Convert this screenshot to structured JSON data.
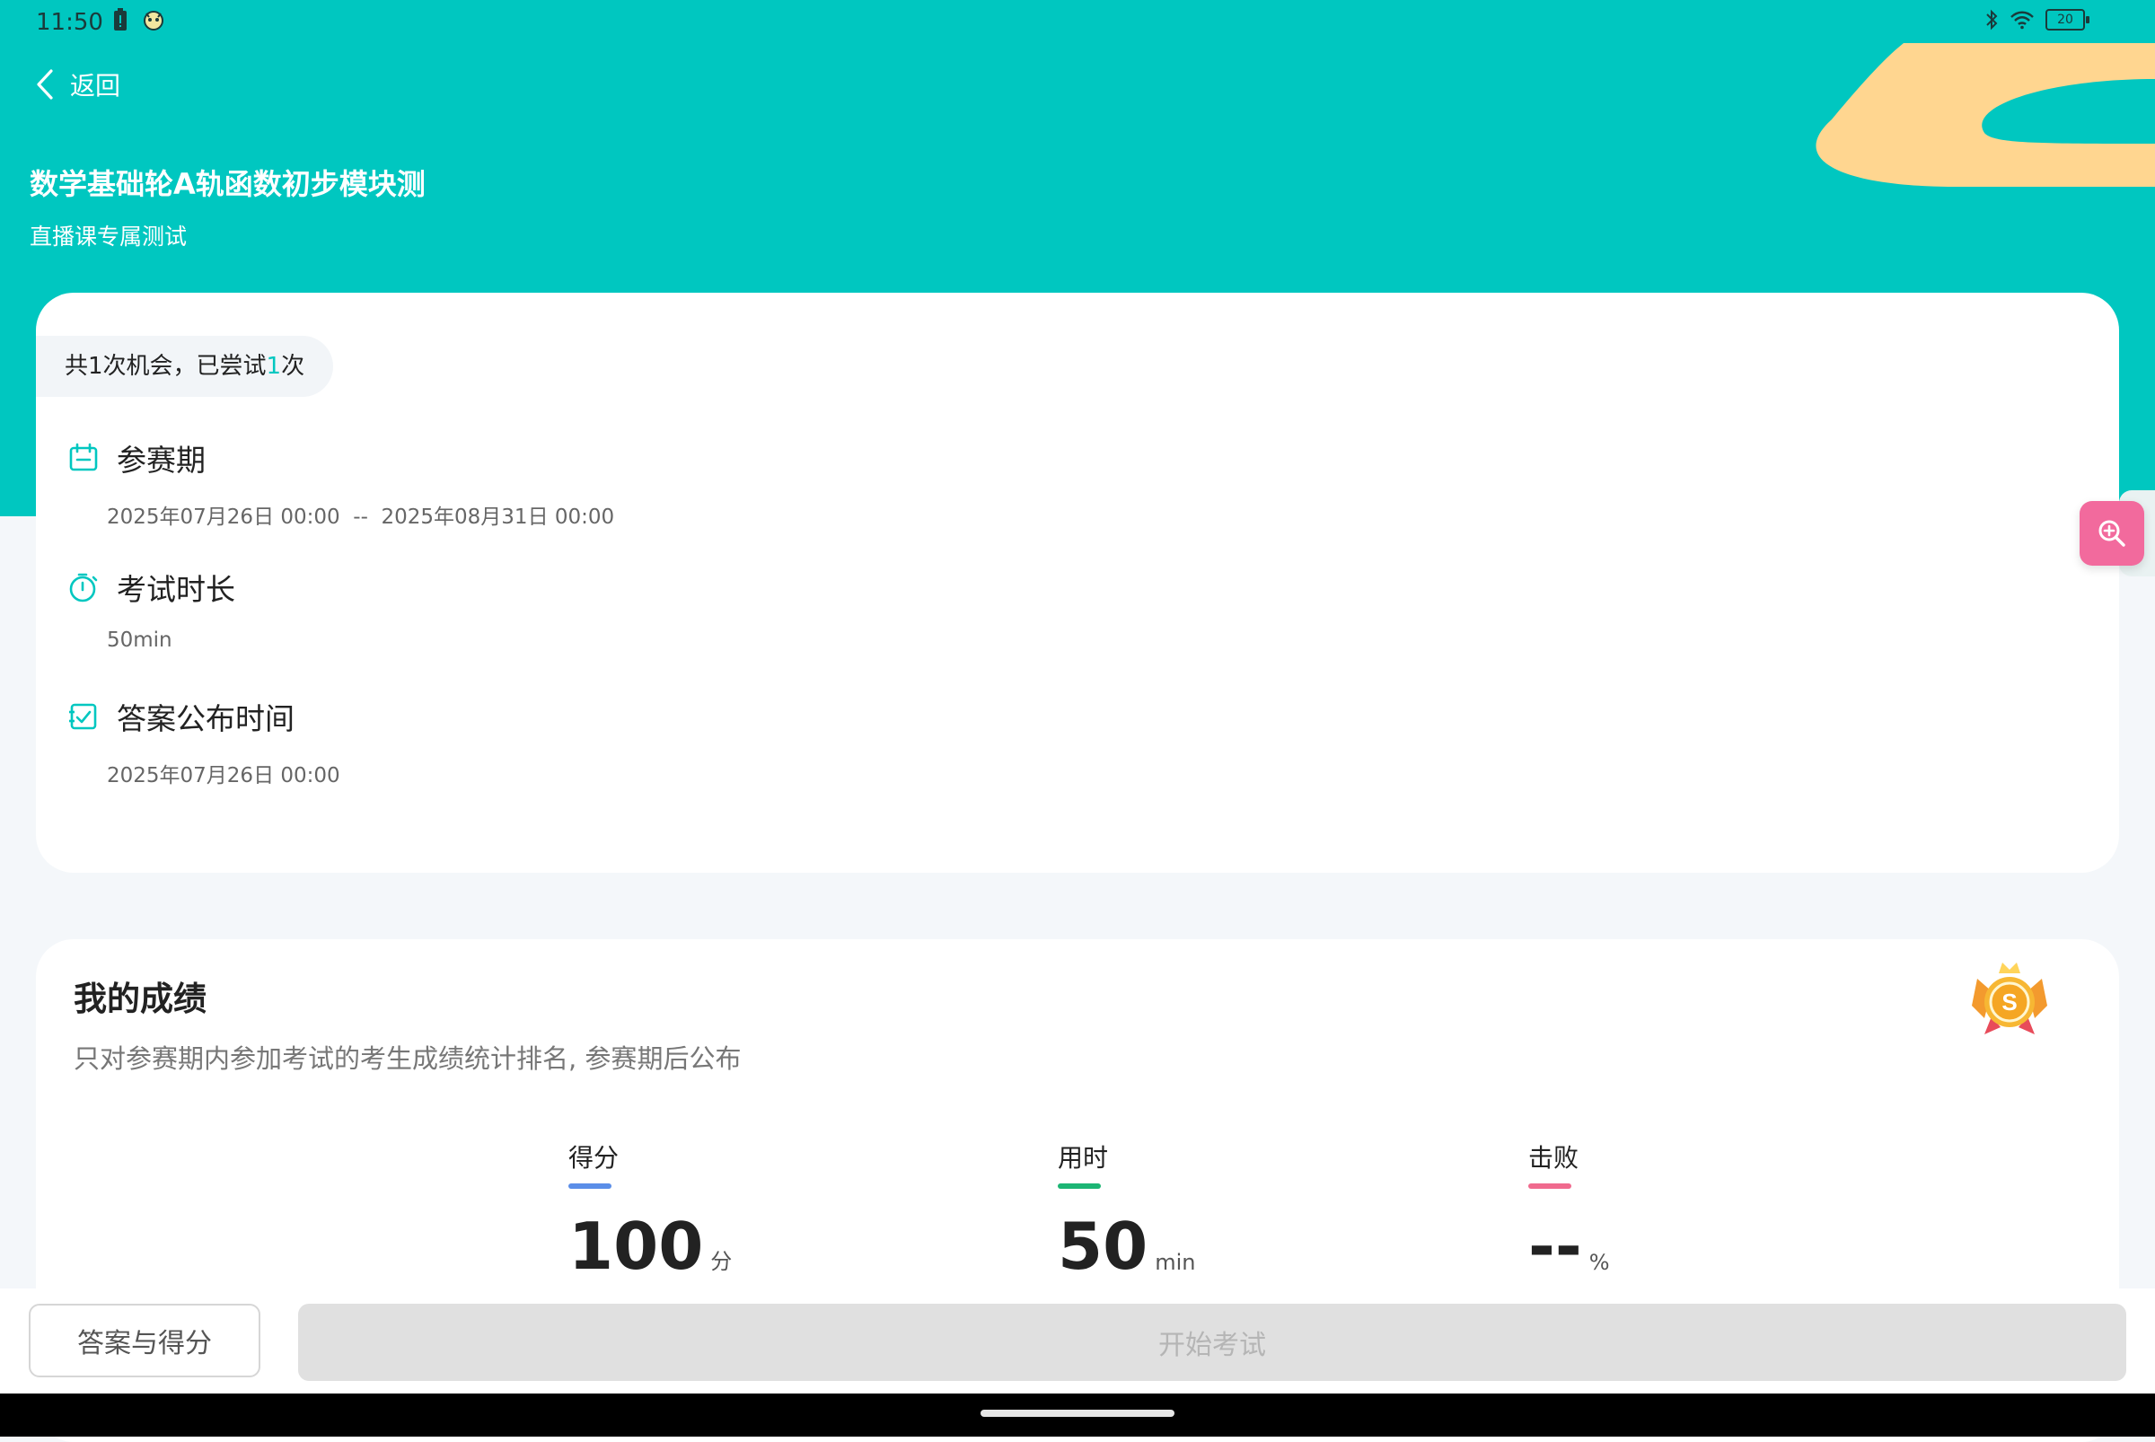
{
  "status_bar": {
    "time": "11:50",
    "battery_level": "20"
  },
  "header": {
    "back_label": "返回",
    "title": "数学基础轮A轨函数初步模块测",
    "subtitle": "直播课专属测试"
  },
  "exam_info": {
    "chances_prefix": "共1次机会，已尝试",
    "chances_used": "1",
    "chances_suffix": "次",
    "rows": [
      {
        "icon": "calendar-icon",
        "label": "参赛期",
        "value": "2025年07月26日 00:00  --  2025年08月31日 00:00"
      },
      {
        "icon": "stopwatch-icon",
        "label": "考试时长",
        "value": "50min"
      },
      {
        "icon": "answer-check-icon",
        "label": "答案公布时间",
        "value": "2025年07月26日 00:00"
      }
    ]
  },
  "score": {
    "title": "我的成绩",
    "note": "只对参赛期内参加考试的考生成绩统计排名, 参赛期后公布",
    "stats": [
      {
        "label": "得分",
        "value": "100",
        "unit": "分",
        "color": "#5b8ee8"
      },
      {
        "label": "用时",
        "value": "50",
        "unit": "min",
        "color": "#1cb574"
      },
      {
        "label": "击败",
        "value": "--",
        "unit": "%",
        "color": "#f06a8e"
      }
    ]
  },
  "actions": {
    "answer_button": "答案与得分",
    "start_button": "开始考试"
  },
  "colors": {
    "accent": "#00c7c0",
    "float_button": "#f26a9d"
  }
}
